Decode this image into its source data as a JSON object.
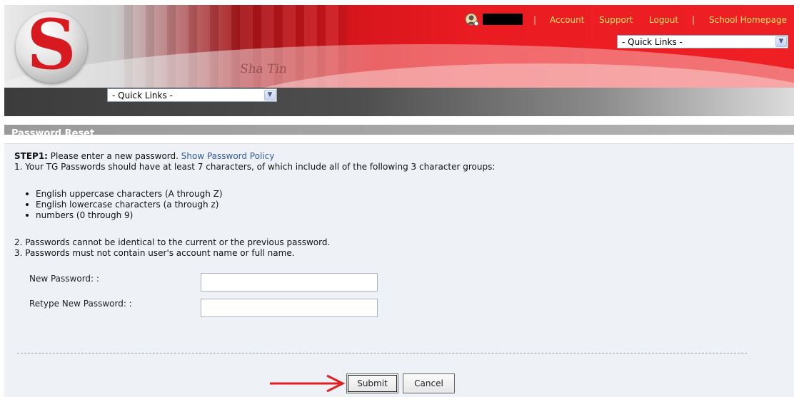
{
  "header": {
    "user_name": "",
    "nav": {
      "account": "Account",
      "support": "Support",
      "logout": "Logout",
      "school_homepage": "School Homepage",
      "separator": "|"
    },
    "quick_links_top": "- Quick Links -",
    "banner_text": "Sha Tin"
  },
  "navbar": {
    "quick_links": "- Quick Links -"
  },
  "section": {
    "title": "Password Reset"
  },
  "content": {
    "step_label": "STEP1:",
    "step_text": " Please enter a new password. ",
    "show_policy": "Show Password Policy",
    "rule1": "1. Your TG Passwords should have at least 7 characters, of which include all of the following 3 character groups:",
    "groups": [
      "English uppercase characters (A through Z)",
      "English lowercase characters (a through z)",
      "numbers (0 through 9)"
    ],
    "rule2": "2. Passwords cannot be identical to the current or the previous password.",
    "rule3": "3. Passwords must not contain user's account name or full name.",
    "new_password_label": "New Password: :",
    "retype_password_label": "Retype New Password: :",
    "new_password_value": "",
    "retype_password_value": ""
  },
  "buttons": {
    "submit": "Submit",
    "cancel": "Cancel"
  },
  "colors": {
    "brand_red": "#e31b23",
    "nav_link": "#ffe36a",
    "link_blue": "#335a99",
    "annotation_arrow": "#e02020"
  },
  "icons": {
    "avatar": "user-avatar-icon",
    "dropdown": "chevron-down-icon",
    "annotation": "red-arrow-icon"
  }
}
